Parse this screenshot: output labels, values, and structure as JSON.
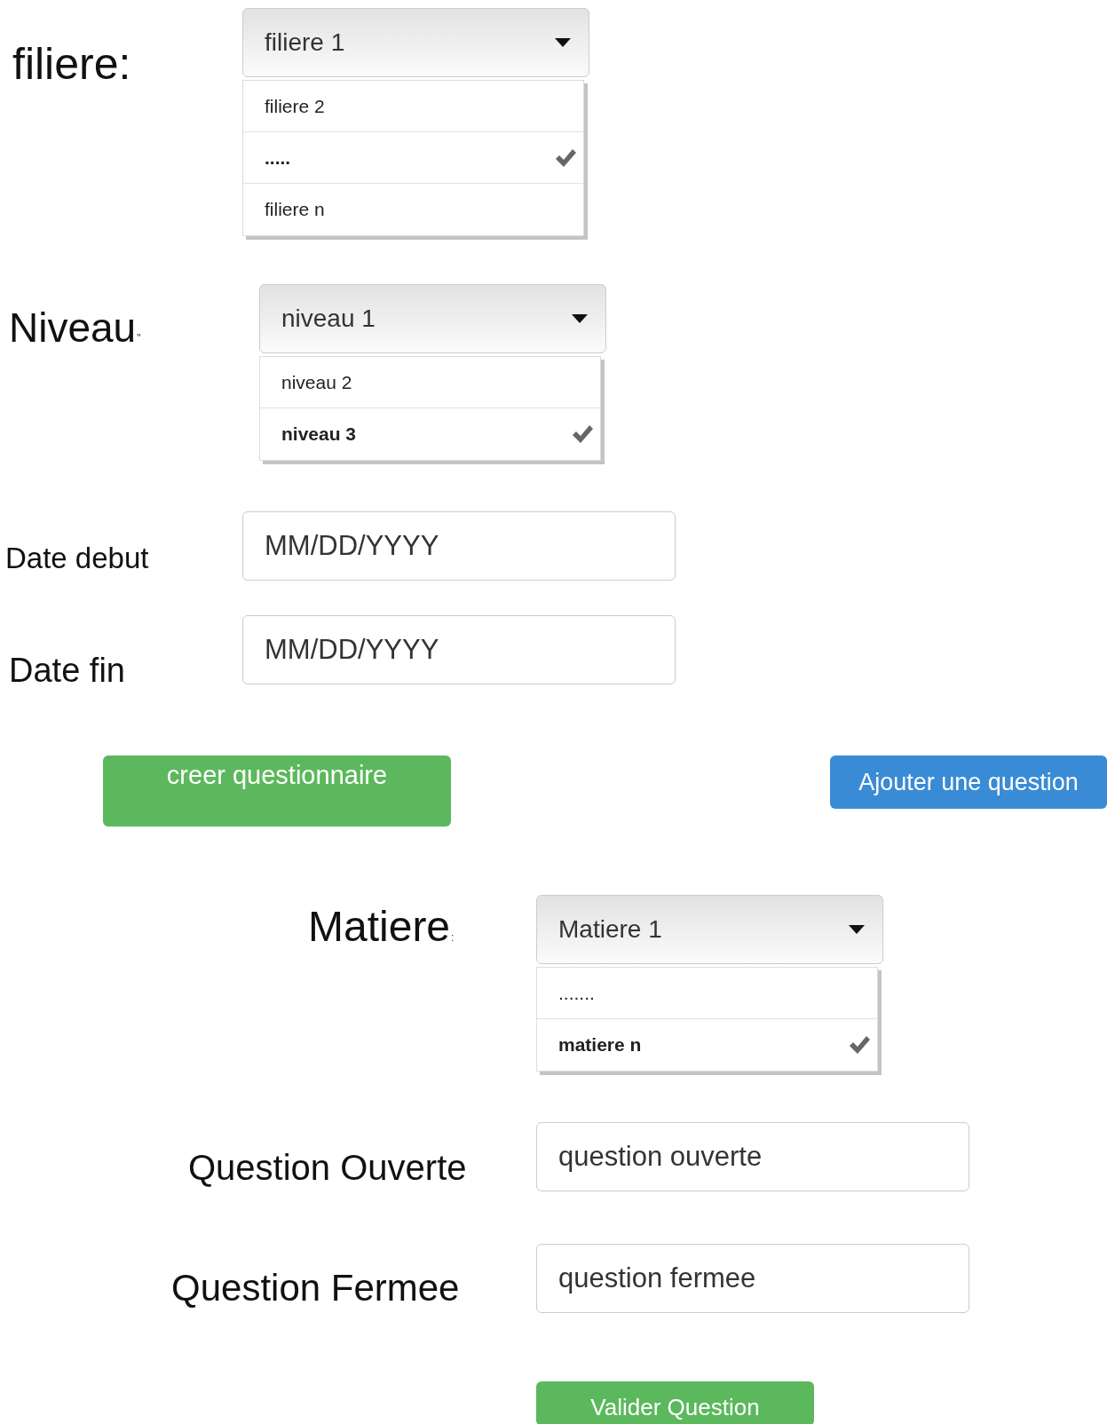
{
  "filiere": {
    "label": "filiere:",
    "select": {
      "value": "filiere 1",
      "options": [
        {
          "label": "filiere 2",
          "selected": false
        },
        {
          "label": ".....",
          "selected": true
        },
        {
          "label": "filiere n",
          "selected": false
        }
      ]
    }
  },
  "niveau": {
    "label": "Niveau",
    "label_mark": "\"",
    "select": {
      "value": "niveau 1",
      "options": [
        {
          "label": "niveau 2",
          "selected": false
        },
        {
          "label": "niveau 3",
          "selected": true
        }
      ]
    }
  },
  "date_debut": {
    "label": "Date debut",
    "placeholder": "MM/DD/YYYY"
  },
  "date_fin": {
    "label": "Date fin",
    "placeholder": "MM/DD/YYYY"
  },
  "create_button": "creer questionnaire",
  "add_question_button": "Ajouter une question",
  "matiere": {
    "label": "Matiere",
    "label_mark": ":",
    "select": {
      "value": "Matiere 1",
      "options": [
        {
          "label": ".......",
          "selected": false
        },
        {
          "label": "matiere n",
          "selected": true
        }
      ]
    }
  },
  "question_ouverte": {
    "label": "Question Ouverte",
    "placeholder": "question ouverte"
  },
  "question_fermee": {
    "label": "Question Fermee",
    "placeholder": "question fermee"
  },
  "validate_button": "Valider Question"
}
